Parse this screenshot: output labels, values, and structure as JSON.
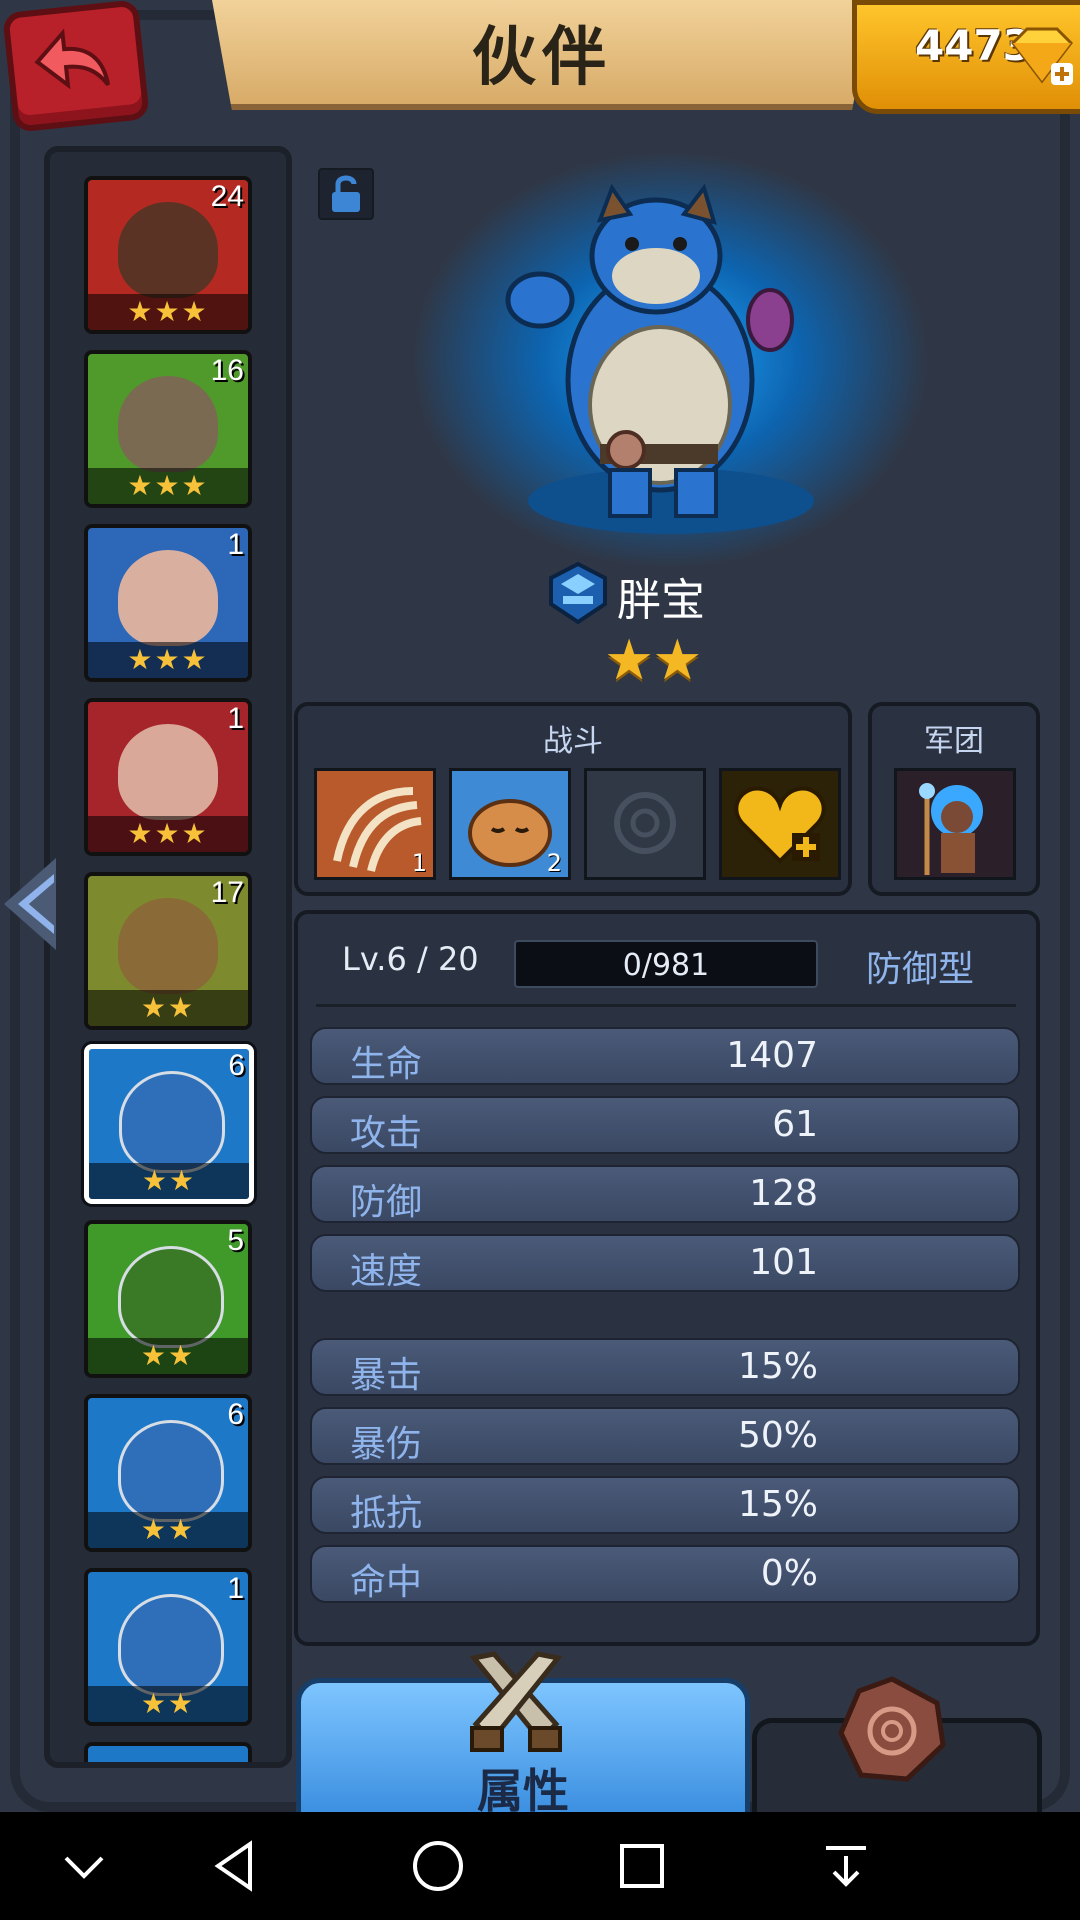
{
  "header": {
    "title": "伙伴",
    "gem_count": "4473"
  },
  "sidebar": {
    "cards": [
      {
        "level": "24",
        "stars": "★★★",
        "color": "#b42a22"
      },
      {
        "level": "16",
        "stars": "★★★",
        "color": "#4f9a2a"
      },
      {
        "level": "1",
        "stars": "★★★",
        "color": "#2d67b8"
      },
      {
        "level": "1",
        "stars": "★★★",
        "color": "#a5252a"
      },
      {
        "level": "17",
        "stars": "★★",
        "color": "#7d8a2e"
      },
      {
        "level": "6",
        "stars": "★★",
        "color": "#1e78c8",
        "selected": true
      },
      {
        "level": "5",
        "stars": "★★",
        "color": "#3f9a2a"
      },
      {
        "level": "6",
        "stars": "★★",
        "color": "#1e78c8"
      },
      {
        "level": "1",
        "stars": "★★",
        "color": "#1e78c8"
      }
    ]
  },
  "hero": {
    "name": "胖宝",
    "stars": "★★"
  },
  "battle_panel": {
    "title": "战斗",
    "skills": [
      {
        "icon": "claw-skill-icon",
        "count": "1"
      },
      {
        "icon": "sleeping-beast-skill-icon",
        "count": "2"
      },
      {
        "icon": "locked-rune-skill-icon",
        "count": ""
      },
      {
        "icon": "heart-plus-skill-icon",
        "count": ""
      }
    ]
  },
  "legion_panel": {
    "title": "军团"
  },
  "stats": {
    "level_text": "Lv.6 / 20",
    "xp_text": "0/981",
    "xp_fraction": 0,
    "role": "防御型",
    "rows": [
      {
        "label": "生命",
        "value": "1407"
      },
      {
        "label": "攻击",
        "value": "61"
      },
      {
        "label": "防御",
        "value": "128"
      },
      {
        "label": "速度",
        "value": "101"
      },
      {
        "label": "暴击",
        "value": "15%"
      },
      {
        "label": "暴伤",
        "value": "50%"
      },
      {
        "label": "抵抗",
        "value": "15%"
      },
      {
        "label": "命中",
        "value": "0%"
      }
    ]
  },
  "tabs": {
    "active_label": "属性"
  },
  "colors": {
    "accent_blue": "#8fb4ec",
    "gold": "#f3b824",
    "gem_orange": "#f2a814"
  }
}
